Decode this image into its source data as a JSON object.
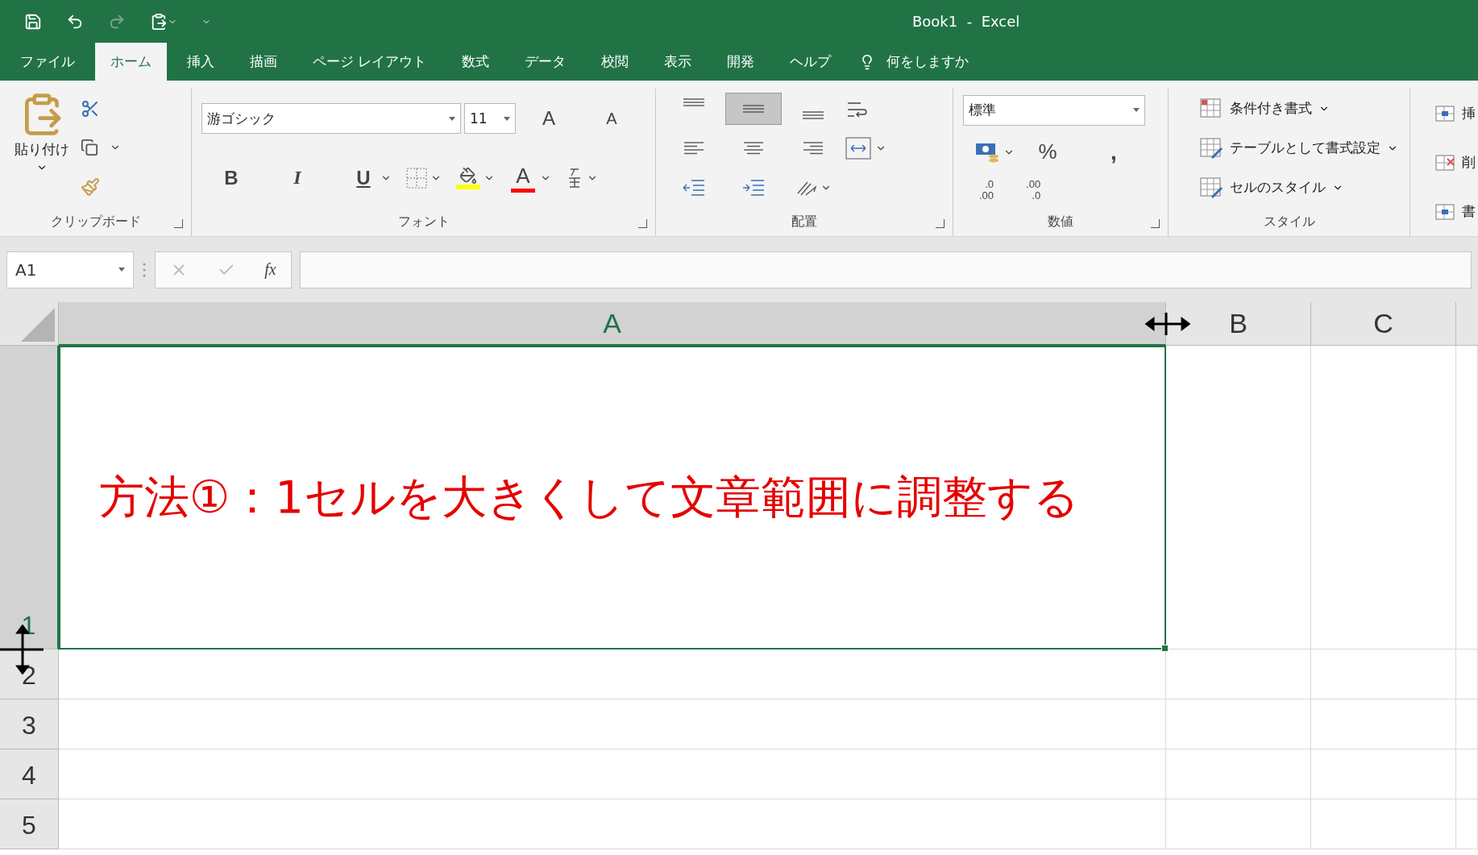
{
  "title_bar": {
    "title": "Book1  -  Excel"
  },
  "tabs": [
    {
      "label": "ファイル",
      "selected": false
    },
    {
      "label": "ホーム",
      "selected": true
    },
    {
      "label": "挿入",
      "selected": false
    },
    {
      "label": "描画",
      "selected": false
    },
    {
      "label": "ページ レイアウト",
      "selected": false
    },
    {
      "label": "数式",
      "selected": false
    },
    {
      "label": "データ",
      "selected": false
    },
    {
      "label": "校閲",
      "selected": false
    },
    {
      "label": "表示",
      "selected": false
    },
    {
      "label": "開発",
      "selected": false
    },
    {
      "label": "ヘルプ",
      "selected": false
    }
  ],
  "tell_me": "何をしますか",
  "ribbon": {
    "clipboard": {
      "paste": "貼り付け",
      "group_label": "クリップボード"
    },
    "font": {
      "font_name": "游ゴシック",
      "font_size": "11",
      "grow": "A",
      "shrink": "A",
      "bold": "B",
      "italic": "I",
      "underline": "U",
      "font_color": "A",
      "group_label": "フォント"
    },
    "alignment": {
      "vertical": [
        {
          "selected": false
        },
        {
          "selected": true
        },
        {
          "selected": false
        }
      ],
      "group_label": "配置"
    },
    "number": {
      "format": "標準",
      "percent": "%",
      "comma": ",",
      "increase_decimal": [
        ".0",
        ".00"
      ],
      "decrease_decimal": [
        ".00",
        ".0"
      ],
      "group_label": "数値"
    },
    "styles": {
      "items": [
        "条件付き書式",
        "テーブルとして書式設定",
        "セルのスタイル"
      ],
      "group_label": "スタイル"
    },
    "cells": {
      "items": [
        "挿",
        "削",
        "書"
      ]
    }
  },
  "formula_bar": {
    "name_box": "A1",
    "function_label": "fx"
  },
  "grid": {
    "columns": [
      {
        "label": "A",
        "selected": true
      },
      {
        "label": "B",
        "selected": false
      },
      {
        "label": "C",
        "selected": false
      }
    ],
    "rows": [
      {
        "label": "1",
        "selected": true
      },
      {
        "label": "2",
        "selected": false
      },
      {
        "label": "3",
        "selected": false
      },
      {
        "label": "4",
        "selected": false
      },
      {
        "label": "5",
        "selected": false
      }
    ],
    "cell_a1": "方法①：1セルを大きくして文章範囲に調整する"
  }
}
